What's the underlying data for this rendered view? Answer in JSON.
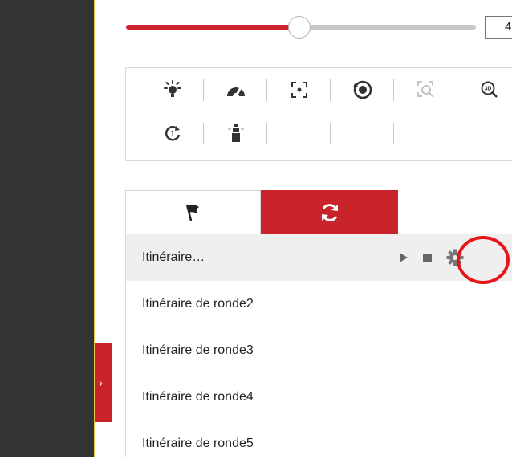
{
  "speed": {
    "value": "4",
    "level_percent": 53
  },
  "controls": {
    "row1": [
      "light-icon",
      "wiper-icon",
      "focus-area-icon",
      "manual-track-icon",
      "zoom-3d-icon-disabled",
      "zoom-3d-icon"
    ],
    "row2": [
      "one-touch-patrol-icon",
      "park-icon"
    ]
  },
  "tabs": [
    {
      "name": "preset-tab",
      "icon": "flag-icon",
      "active": false
    },
    {
      "name": "patrol-tab",
      "icon": "patrol-cycle-icon",
      "active": true
    }
  ],
  "patrols": [
    {
      "label": "Itinéraire…",
      "selected": true
    },
    {
      "label": "Itinéraire de ronde2"
    },
    {
      "label": "Itinéraire de ronde3"
    },
    {
      "label": "Itinéraire de ronde4"
    },
    {
      "label": "Itinéraire de ronde5"
    }
  ],
  "colors": {
    "accent": "#c9232c",
    "sidebar": "#333333",
    "annotation": "#e8141c"
  }
}
